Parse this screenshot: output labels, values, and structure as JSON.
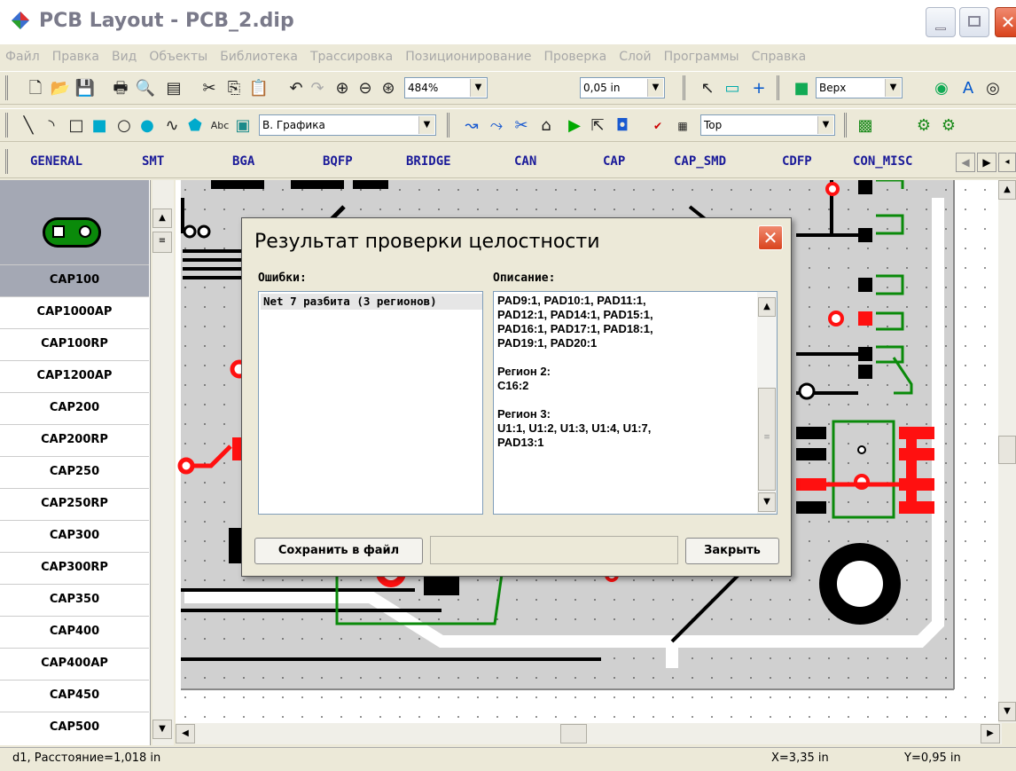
{
  "window": {
    "title": "PCB Layout - PCB_2.dip"
  },
  "menu": [
    "Файл",
    "Правка",
    "Вид",
    "Объекты",
    "Библиотека",
    "Трассировка",
    "Позиционирование",
    "Проверка",
    "Слой",
    "Программы",
    "Справка"
  ],
  "toolbar1": {
    "zoom": "484%",
    "grid": "0,05 in",
    "layer": "Верх"
  },
  "toolbar2": {
    "graphics_mode": "В. Графика",
    "layer_combo": "Top"
  },
  "library_tabs": [
    "GENERAL",
    "SMT",
    "BGA",
    "BQFP",
    "BRIDGE",
    "CAN",
    "CAP",
    "CAP_SMD",
    "CDFP",
    "CON_MISC"
  ],
  "components": [
    "CAP100",
    "CAP1000AP",
    "CAP100RP",
    "CAP1200AP",
    "CAP200",
    "CAP200RP",
    "CAP250",
    "CAP250RP",
    "CAP300",
    "CAP300RP",
    "CAP350",
    "CAP400",
    "CAP400AP",
    "CAP450",
    "CAP500"
  ],
  "selected_component": "CAP100",
  "dialog": {
    "title": "Результат проверки целостности",
    "errors_label": "Ошибки:",
    "description_label": "Описание:",
    "error_item": "Net 7 разбита (3 регионов)",
    "description": "PAD9:1, PAD10:1, PAD11:1,\nPAD12:1, PAD14:1, PAD15:1,\nPAD16:1, PAD17:1, PAD18:1,\nPAD19:1, PAD20:1\n\nРегион 2:\nC16:2\n\nРегион 3:\nU1:1, U1:2, U1:3, U1:4, U1:7,\nPAD13:1",
    "save_button": "Сохранить в файл",
    "close_button": "Закрыть"
  },
  "status": {
    "distance": "d1, Расстояние=1,018 in",
    "x": "X=3,35 in",
    "y": "Y=0,95 in"
  },
  "colors": {
    "trace_black": "#000000",
    "trace_green": "#0a8a0a",
    "pad_red": "#ff1010",
    "board_gray": "#d0d0d0"
  }
}
